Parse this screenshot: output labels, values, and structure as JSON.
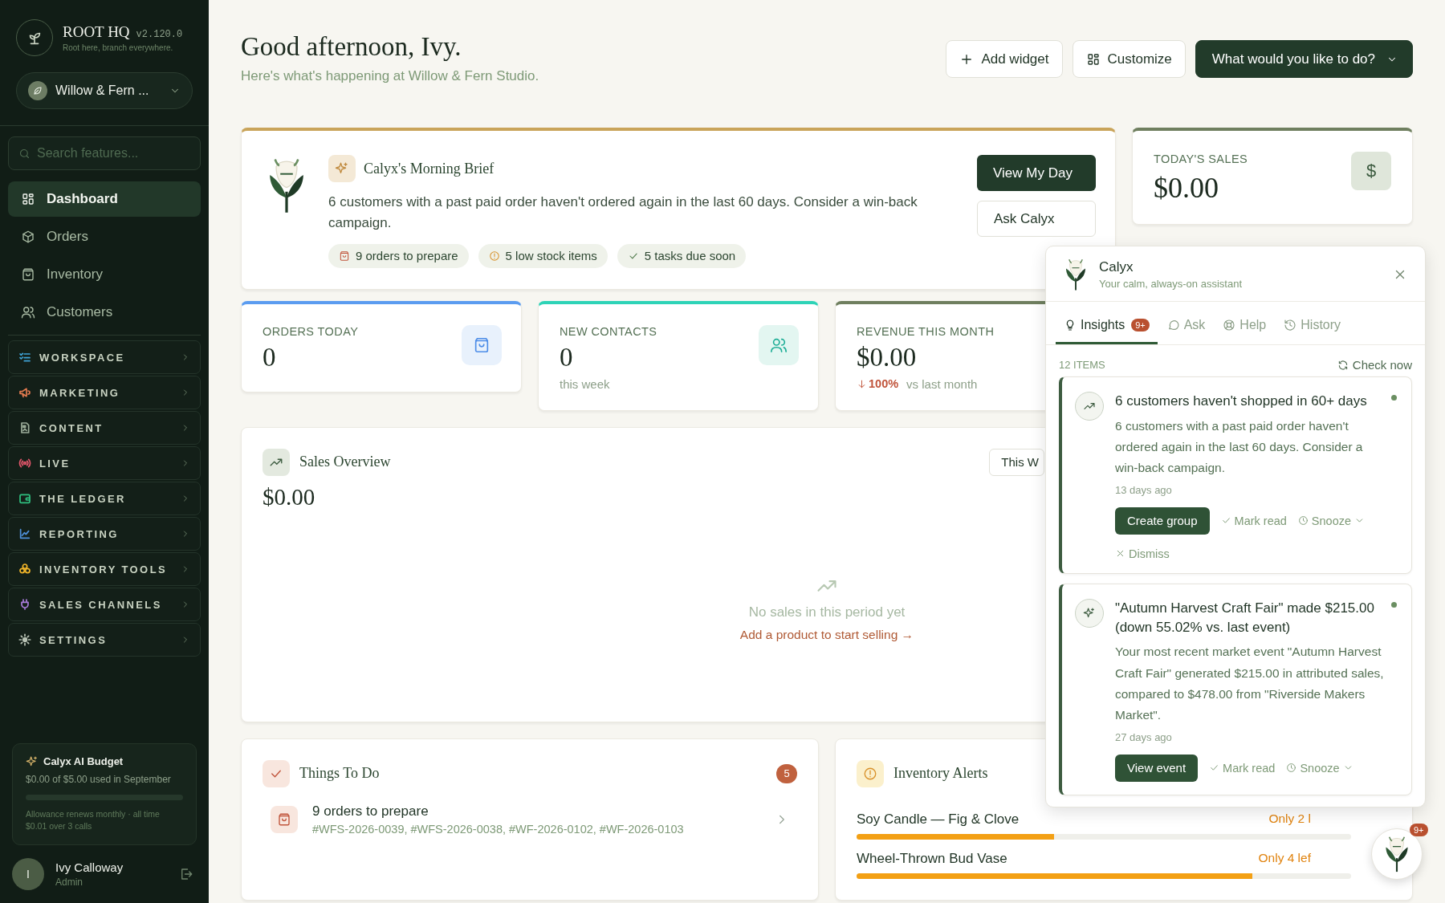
{
  "sidebar": {
    "brand": {
      "name": "ROOT HQ",
      "version": "v2.120.0",
      "tagline": "Root here, branch everywhere."
    },
    "store": {
      "name": "Willow & Fern ..."
    },
    "search": {
      "placeholder": "Search features..."
    },
    "nav": [
      {
        "label": "Dashboard",
        "selected": true
      },
      {
        "label": "Orders",
        "selected": false
      },
      {
        "label": "Inventory",
        "selected": false
      },
      {
        "label": "Customers",
        "selected": false
      }
    ],
    "sections": [
      {
        "label": "WORKSPACE",
        "color": "#3fa3d6"
      },
      {
        "label": "MARKETING",
        "color": "#e07a4f"
      },
      {
        "label": "CONTENT",
        "color": "#9aab98"
      },
      {
        "label": "LIVE",
        "color": "#e0566a"
      },
      {
        "label": "THE LEDGER",
        "color": "#2fbf7f"
      },
      {
        "label": "REPORTING",
        "color": "#4e8fd8"
      },
      {
        "label": "INVENTORY TOOLS",
        "color": "#f0b429"
      },
      {
        "label": "SALES CHANNELS",
        "color": "#a77bd9"
      },
      {
        "label": "SETTINGS",
        "color": "#b8c2b4"
      }
    ],
    "budget": {
      "title": "Calyx AI Budget",
      "usage": "$0.00 of $5.00 used in September",
      "level": 0,
      "note": "Allowance renews monthly · all time $0.01 over 3 calls"
    },
    "user": {
      "initial": "I",
      "name": "Ivy Calloway",
      "role": "Admin"
    }
  },
  "header": {
    "title": "Good afternoon, Ivy.",
    "subtitle": "Here's what's happening at Willow & Fern Studio.",
    "buttons": [
      {
        "label": "Add widget",
        "kind": "add"
      },
      {
        "label": "Customize",
        "kind": "grid"
      },
      {
        "label": "What would you like to do?",
        "kind": "primary"
      }
    ]
  },
  "brief": {
    "title": "Calyx's Morning Brief",
    "text": "6 customers with a past paid order haven't ordered again in the last 60 days. Consider a win-back campaign.",
    "chips": [
      {
        "label": "9 orders to prepare",
        "kind": "bag"
      },
      {
        "label": "5 low stock items",
        "kind": "alert"
      },
      {
        "label": "5 tasks due soon",
        "kind": "check"
      }
    ],
    "buttons": [
      {
        "label": "View My Day",
        "kind": "primary"
      },
      {
        "label": "Ask Calyx",
        "kind": "secondary"
      }
    ]
  },
  "todays_sales": {
    "label": "TODAY'S SALES",
    "value": "$0.00",
    "icon": "$"
  },
  "stats": [
    {
      "label": "ORDERS TODAY",
      "value": "0",
      "color": "#5b9cf0",
      "kind": "bag"
    },
    {
      "label": "NEW CONTACTS",
      "value": "0",
      "note": "this week",
      "color": "#2ed3b7",
      "kind": "people"
    },
    {
      "label": "REVENUE THIS MONTH",
      "value": "$0.00",
      "change": "100%",
      "note": "vs last month",
      "color": "#6f7f5f",
      "kind": "none"
    }
  ],
  "sales_overview": {
    "title": "Sales Overview",
    "value": "$0.00",
    "period": "This W",
    "empty": "No sales in this period yet",
    "link": "Add a product to start selling →"
  },
  "things_to_do": {
    "title": "Things To Do",
    "count": "5",
    "items": [
      {
        "title": "9 orders to prepare",
        "detail": "#WFS-2026-0039, #WFS-2026-0038, #WF-2026-0102, #WF-2026-0103"
      }
    ]
  },
  "inventory_alerts": {
    "title": "Inventory Alerts",
    "items": [
      {
        "name": "Soy Candle — Fig & Clove",
        "status": "Only 2 l",
        "level": 0.4
      },
      {
        "name": "Wheel-Thrown Bud Vase",
        "status": "Only 4 lef",
        "level": 0.8
      }
    ]
  },
  "assistant": {
    "name": "Calyx",
    "tagline": "Your calm, always-on assistant",
    "tabs": [
      {
        "label": "Insights",
        "selected": true,
        "badge": "9+"
      },
      {
        "label": "Ask",
        "selected": false
      },
      {
        "label": "Help",
        "selected": false
      },
      {
        "label": "History",
        "selected": false
      }
    ],
    "count": "12 ITEMS",
    "refresh": "Check now",
    "insights": [
      {
        "kind": "trend",
        "title": "6 customers haven't shopped in 60+ days",
        "body": "6 customers with a past paid order haven't ordered again in the last 60 days. Consider a win-back campaign.",
        "time": "13 days ago",
        "unread": true,
        "action": "Create group",
        "mark": "Mark read",
        "snooze": "Snooze",
        "dismiss": "Dismiss"
      },
      {
        "kind": "sparkle",
        "title": "\"Autumn Harvest Craft Fair\" made $215.00 (down 55.02% vs. last event)",
        "body": "Your most recent market event \"Autumn Harvest Craft Fair\" generated $215.00 in attributed sales, compared to $478.00 from \"Riverside Makers Market\".",
        "time": "27 days ago",
        "unread": true,
        "action": "View event",
        "mark": "Mark read",
        "snooze": "Snooze"
      }
    ]
  },
  "fab": {
    "badge": "9+"
  }
}
